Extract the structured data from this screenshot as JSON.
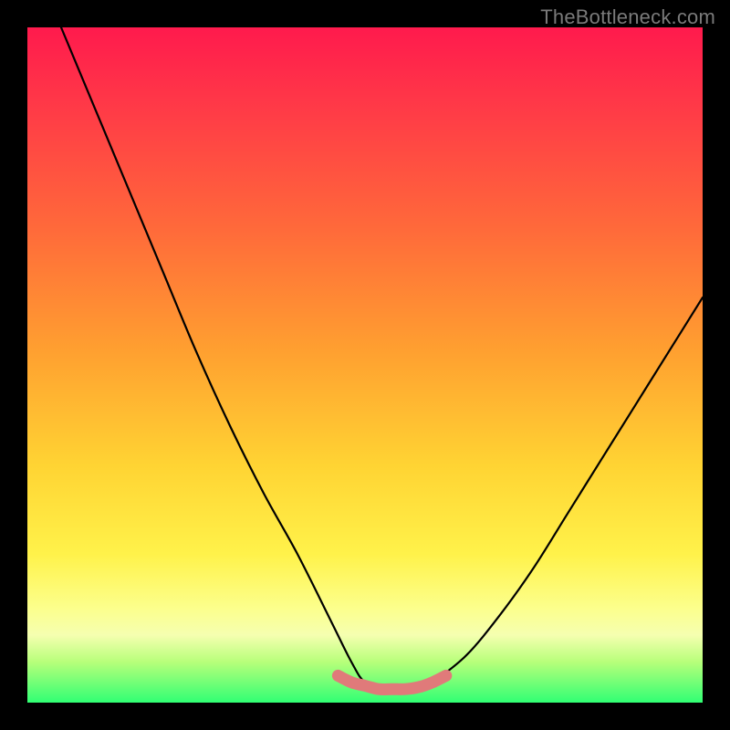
{
  "watermark": "TheBottleneck.com",
  "chart_data": {
    "type": "line",
    "title": "",
    "xlabel": "",
    "ylabel": "",
    "xlim": [
      0,
      100
    ],
    "ylim": [
      0,
      100
    ],
    "series": [
      {
        "name": "bottleneck-curve",
        "x": [
          5,
          10,
          15,
          20,
          25,
          30,
          35,
          40,
          45,
          48,
          50,
          53,
          56,
          58,
          60,
          65,
          70,
          75,
          80,
          85,
          90,
          95,
          100
        ],
        "y": [
          100,
          88,
          76,
          64,
          52,
          41,
          31,
          22,
          12,
          6,
          3,
          2,
          2,
          2,
          3,
          7,
          13,
          20,
          28,
          36,
          44,
          52,
          60
        ]
      },
      {
        "name": "sweet-spot-band",
        "x": [
          46,
          48,
          50,
          52,
          54,
          56,
          58,
          60,
          62
        ],
        "y": [
          4,
          3,
          2.5,
          2,
          2,
          2,
          2.3,
          3,
          4
        ]
      }
    ],
    "colors": {
      "curve": "#000000",
      "band": "#e07a7a",
      "gradient_top": "#ff1a4d",
      "gradient_mid": "#ffd433",
      "gradient_bottom": "#30ff74"
    }
  }
}
